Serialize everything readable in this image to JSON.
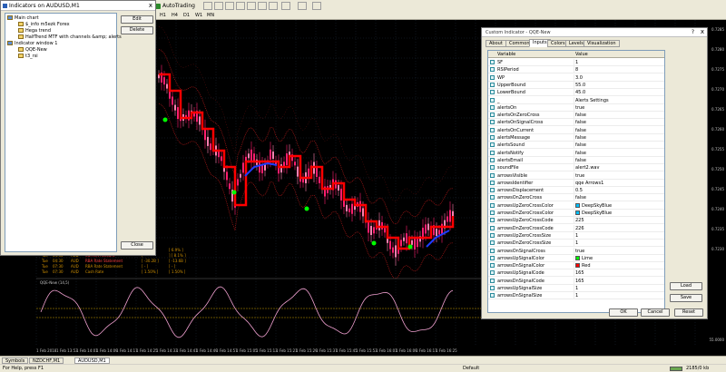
{
  "toolbar": {
    "autotrading_label": "AutoTrading",
    "timeframes": [
      "H1",
      "H4",
      "D1",
      "W1",
      "MN"
    ]
  },
  "indicators_window": {
    "title": "Indicators on AUDUSD,M1",
    "close_x": "x",
    "tree": [
      {
        "label": "Main chart",
        "level": 0
      },
      {
        "label": "$_info m5ezk Forex",
        "level": 1
      },
      {
        "label": "Hega trend",
        "level": 1
      },
      {
        "label": "HalfTrend MTF with channels &amp; alerts",
        "level": 1
      },
      {
        "label": "Indicator window 1",
        "level": 0
      },
      {
        "label": "QQE-New",
        "level": 1
      },
      {
        "label": "t3_rsi",
        "level": 1
      }
    ],
    "buttons": {
      "edit": "Edit",
      "delete": "Delete",
      "close": "Close"
    }
  },
  "news": [
    {
      "day": "Tue",
      "time": "04:01",
      "currency": "GBP",
      "title": "BRC Retail Sales Monitor y/y",
      "actual": "[ 5.7% ]",
      "forecast": "[ 6.9% ]"
    },
    {
      "day": "Tue",
      "time": "04:30",
      "currency": "AUD",
      "title": "Current Account",
      "actual": "[ -",
      "forecast": "] [ 8.1% ]"
    },
    {
      "day": "Tue",
      "time": "04:30",
      "currency": "AUD",
      "title": "RBA Rate Statement",
      "actual": "[ -30.2B ]",
      "forecast": "[ -13.6B ]"
    },
    {
      "day": "Tue",
      "time": "07:30",
      "currency": "AUD",
      "title": "RBA Rate Statement",
      "actual": "[ - ]",
      "forecast": "[ - ]"
    },
    {
      "day": "Tue",
      "time": "07:30",
      "currency": "AUD",
      "title": "Cash Rate",
      "actual": "[ 1.50% ]",
      "forecast": "[ 1.50% ]"
    }
  ],
  "subwindow": {
    "title": "QQE-New (14,5)",
    "value": "55.0000"
  },
  "price_labels": [
    "0.7285",
    "0.7280",
    "0.7275",
    "0.7270",
    "0.7265",
    "0.7260",
    "0.7255",
    "0.7250",
    "0.7245",
    "0.7240",
    "0.7235",
    "0.7230"
  ],
  "time_labels": [
    "1 Feb 2018",
    "1 Feb 13:53",
    "1 Feb 14:01",
    "1 Feb 14:09",
    "1 Feb 14:17",
    "1 Feb 14:25",
    "1 Feb 14:33",
    "1 Feb 14:41",
    "1 Feb 14:49",
    "1 Feb 14:57",
    "1 Feb 15:05",
    "1 Feb 15:13",
    "1 Feb 15:21",
    "1 Feb 15:29",
    "1 Feb 15:37",
    "1 Feb 15:45",
    "1 Feb 15:53",
    "1 Feb 16:01",
    "1 Feb 16:09",
    "1 Feb 16:17",
    "1 Feb 16:25"
  ],
  "bottom_tabs": [
    "Symbols",
    "NZDCHF,M1",
    "AUDUSD,M1"
  ],
  "status": {
    "help": "For Help, press F1",
    "profile": "Default",
    "traffic": "2185/0 kb"
  },
  "dialog": {
    "title": "Custom Indicator - QQE-New",
    "help": "?",
    "close_x": "x",
    "tabs": [
      "About",
      "Common",
      "Inputs",
      "Colors",
      "Levels",
      "Visualization"
    ],
    "active_tab": "Inputs",
    "headers": {
      "variable": "Variable",
      "value": "Value"
    },
    "rows": [
      {
        "var": "SF",
        "val": "1"
      },
      {
        "var": "RSIPeriod",
        "val": "8"
      },
      {
        "var": "WP",
        "val": "3.0"
      },
      {
        "var": "UpperBound",
        "val": "55.0"
      },
      {
        "var": "LowerBound",
        "val": "45.0"
      },
      {
        "var": "_",
        "val": "Alerts Settings"
      },
      {
        "var": "alertsOn",
        "val": "true"
      },
      {
        "var": "alertsOnZeroCross",
        "val": "false"
      },
      {
        "var": "alertsOnSignalCross",
        "val": "false"
      },
      {
        "var": "alertsOnCurrent",
        "val": "false"
      },
      {
        "var": "alertsMessage",
        "val": "false"
      },
      {
        "var": "alertsSound",
        "val": "false"
      },
      {
        "var": "alertsNotify",
        "val": "false"
      },
      {
        "var": "alertsEmail",
        "val": "false"
      },
      {
        "var": "soundFile",
        "val": "alert2.wav"
      },
      {
        "var": "arrowsVisible",
        "val": "true"
      },
      {
        "var": "arrowsIdentifier",
        "val": "qqe Arrows1"
      },
      {
        "var": "arrowsDisplacement",
        "val": "0.5"
      },
      {
        "var": "arrowsOnZeroCross",
        "val": "false"
      },
      {
        "var": "arrowsUpZeroCrossColor",
        "val": "DeepSkyBlue",
        "swatch": "#00bfff"
      },
      {
        "var": "arrowsDnZeroCrossColor",
        "val": "DeepSkyBlue",
        "swatch": "#00bfff"
      },
      {
        "var": "arrowsUpZeroCrossCode",
        "val": "225"
      },
      {
        "var": "arrowsDnZeroCrossCode",
        "val": "226"
      },
      {
        "var": "arrowsUpZeroCrossSize",
        "val": "1"
      },
      {
        "var": "arrowsDnZeroCrossSize",
        "val": "1"
      },
      {
        "var": "arrowsOnSignalCross",
        "val": "true"
      },
      {
        "var": "arrowsUpSignalColor",
        "val": "Lime",
        "swatch": "#00ff00"
      },
      {
        "var": "arrowsDnSignalColor",
        "val": "Red",
        "swatch": "#ff0000"
      },
      {
        "var": "arrowsUpSignalCode",
        "val": "165"
      },
      {
        "var": "arrowsDnSignalCode",
        "val": "165"
      },
      {
        "var": "arrowsUpSignalSize",
        "val": "1"
      },
      {
        "var": "arrowsDnSignalSize",
        "val": "1"
      }
    ],
    "buttons": {
      "load": "Load",
      "save": "Save",
      "ok": "OK",
      "cancel": "Cancel",
      "reset": "Reset"
    }
  },
  "colors": {
    "candle": "#ff1e6e",
    "halftrend_red": "#ff0000",
    "halftrend_blue": "#1e3cff",
    "channel": "#b01818",
    "qqe_line": "#f0a0d0",
    "level_line": "#c8a000",
    "accent": "#2a5fb5"
  }
}
